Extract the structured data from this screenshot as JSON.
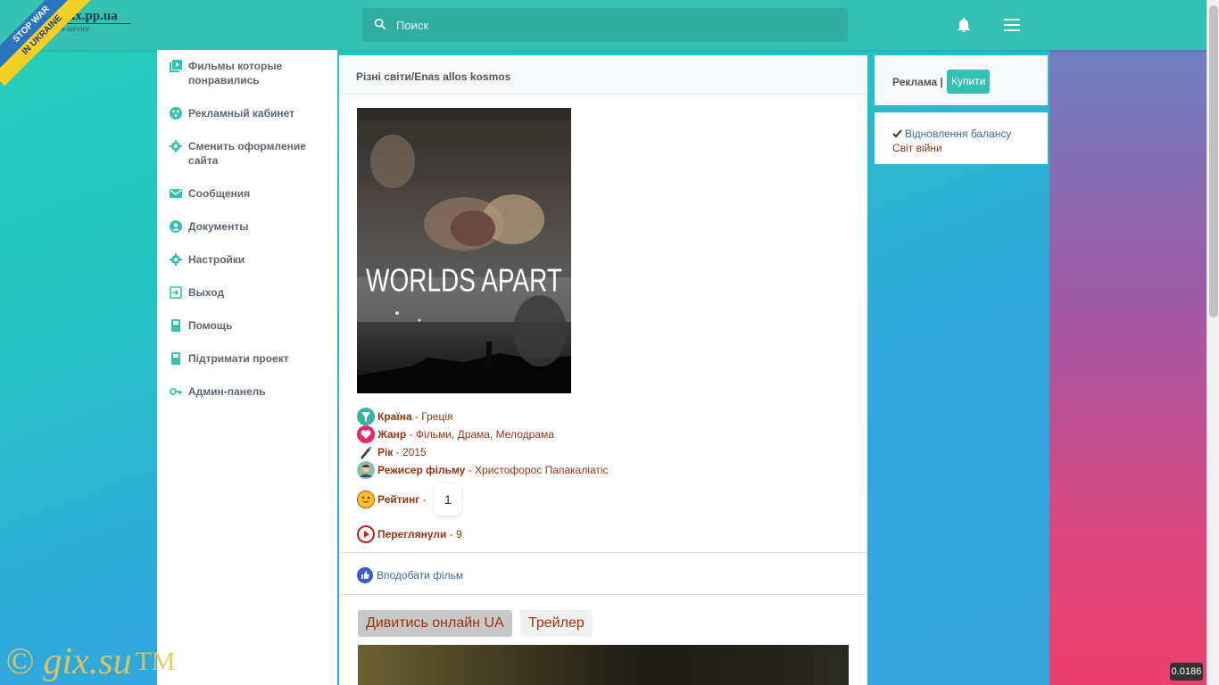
{
  "header": {
    "logo_text": "amix.pp.ua",
    "logo_sub": "UA-service",
    "ribbon_line1": "STOP WAR",
    "ribbon_line2": "IN UKRAINE",
    "search_placeholder": "Поиск",
    "icons": {
      "search": "search-icon",
      "bell": "bell-icon",
      "menu": "menu-icon"
    }
  },
  "sidebar": {
    "items": [
      {
        "label": "Фильмы которые понравились",
        "icon": "film-list-icon"
      },
      {
        "label": "Рекламный кабинет",
        "icon": "ads-icon"
      },
      {
        "label": "Сменить оформление сайта",
        "icon": "gear-icon"
      },
      {
        "label": "Сообщения",
        "icon": "mail-icon"
      },
      {
        "label": "Документы",
        "icon": "account-icon"
      },
      {
        "label": "Настройки",
        "icon": "gear-icon"
      },
      {
        "label": "Выход",
        "icon": "logout-icon"
      },
      {
        "label": "Помощь",
        "icon": "book-icon"
      },
      {
        "label": "Підтримати проект",
        "icon": "book-icon"
      },
      {
        "label": "Админ-панель",
        "icon": "key-icon"
      }
    ]
  },
  "movie": {
    "title": "Різні світи/Enas allos kosmos",
    "poster_text": "WORLDS APART",
    "country_label": "Країна",
    "country": "Греція",
    "genre_label": "Жанр",
    "genre": "Фільми, Драма, Мелодрама",
    "year_label": "Рік",
    "year": "2015",
    "director_label": "Режисер фільму",
    "director": "Христофорос Папакаліатіс",
    "rating_label": "Рейтинг",
    "rating": "1",
    "views_label": "Переглянули",
    "views": "9",
    "separator": " - ",
    "like_label": "Вподобати фільм",
    "tabs": [
      "Дивитись онлайн UA",
      "Трейлер"
    ]
  },
  "right": {
    "ads_label": "Реклама |",
    "buy_button": "Купити",
    "balance_link": "Відновлення балансу",
    "war_link": "Світ війни"
  },
  "watermark": {
    "text": "© gix.su",
    "tm": "TM"
  },
  "counter": "0.0186",
  "colors": {
    "accent": "#35c1b2",
    "link_brown": "#9b3410",
    "link_blue": "#3d6a9a"
  }
}
